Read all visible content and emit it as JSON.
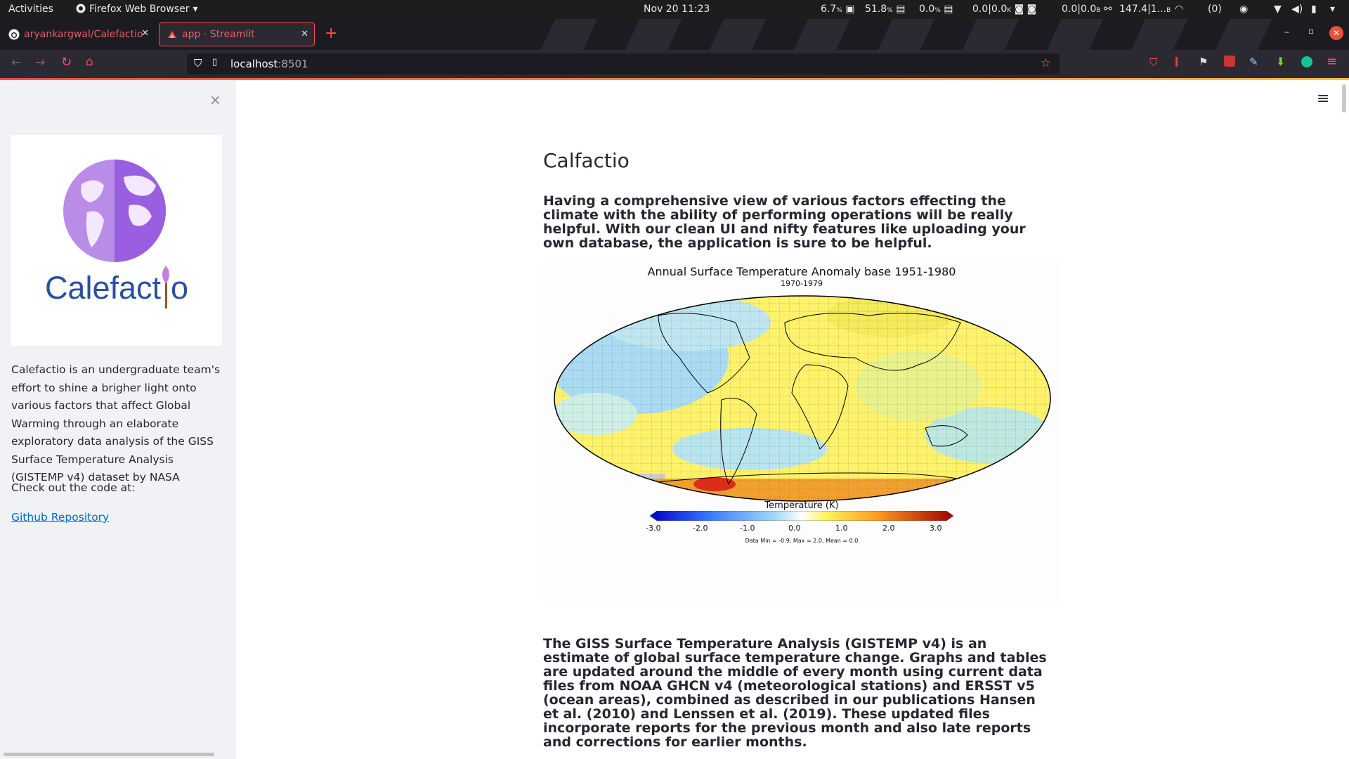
{
  "system_bar": {
    "activities": "Activities",
    "app_name": "Firefox Web Browser",
    "datetime": "Nov 20  11:23",
    "cpu": "6.7",
    "mem": "51.8",
    "swap": "0.0",
    "disk_io": "0.0|0.0",
    "net_io": "0.0|0.0",
    "net_total": "147.4|1...",
    "updates": "(0)"
  },
  "tabs": [
    {
      "title": "aryankargwal/Calefactio",
      "favicon": "github-icon",
      "active": false
    },
    {
      "title": "app · Streamlit",
      "favicon": "streamlit-icon",
      "active": true
    }
  ],
  "url": {
    "host": "localhost",
    "port": ":8501"
  },
  "colors": {
    "accent": "#ff4b4b",
    "sidebar_bg": "#f0f2f6",
    "link": "#0068c9",
    "logo_purple": "#a259e6",
    "logo_text": "#2a4fa0"
  },
  "sidebar": {
    "logo_text_left": "Calefact",
    "logo_text_right": "o",
    "description": "Calefactio is an undergraduate team's effort to shine a brigher light onto various factors that affect Global Warming through an elaborate exploratory data analysis of the GISS Surface Temperature Analysis (GISTEMP v4) dataset by NASA",
    "code_prompt": "Check out the code at:",
    "repo_link": "Github Repository"
  },
  "main": {
    "title": "Calfactio",
    "intro": "Having a comprehensive view of various factors effecting the climate with the ability of performing operations will be really helpful. With our clean UI and nifty features like uploading your own database, the application is sure to be helpful.",
    "map": {
      "title": "Annual Surface Temperature Anomaly base 1951-1980",
      "subtitle": "1970-1979",
      "colorbar_label": "Temperature (K)",
      "colorbar_ticks": [
        "-3.0",
        "-2.0",
        "-1.0",
        "0.0",
        "1.0",
        "2.0",
        "3.0"
      ],
      "stats": "Data Min = -0.9, Max = 2.0, Mean = 0.0"
    },
    "body": "The GISS Surface Temperature Analysis (GISTEMP v4) is an estimate of global surface temperature change. Graphs and tables are updated around the middle of every month using current data files from NOAA GHCN v4 (meteorological stations) and ERSST v5 (ocean areas), combined as described in our publications Hansen et al. (2010) and Lenssen et al. (2019). These updated files incorporate reports for the previous month and also late reports and corrections for earlier months."
  }
}
